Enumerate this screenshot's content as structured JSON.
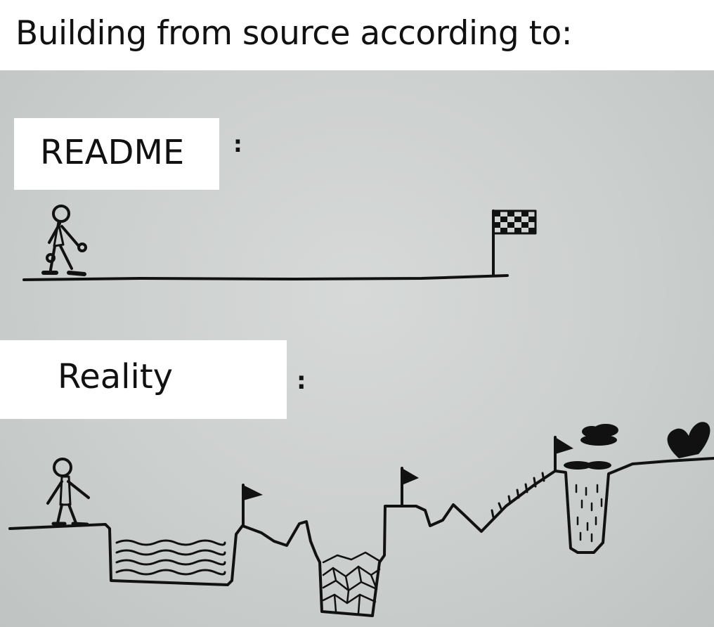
{
  "meme": {
    "caption": "Building from source according to:",
    "panels": [
      {
        "label": "README",
        "separator": ":"
      },
      {
        "label": "Reality",
        "separator": ":"
      }
    ]
  },
  "colors": {
    "paper": "#cbcfcd",
    "ink": "#111111",
    "label_bg": "#ffffff"
  }
}
